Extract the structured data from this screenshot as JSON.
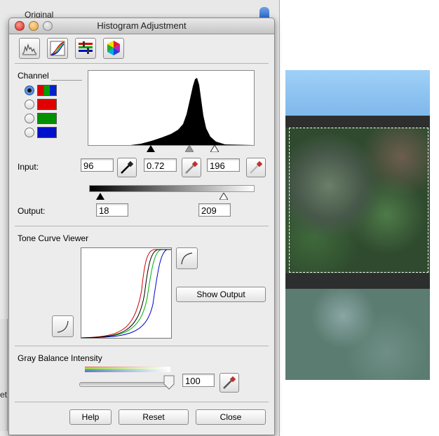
{
  "background_window": {
    "label": "Original",
    "edge_text": "et"
  },
  "dialog": {
    "title": "Histogram Adjustment",
    "toolbar": [
      {
        "icon": "histogram-icon"
      },
      {
        "icon": "tone-curve-icon"
      },
      {
        "icon": "color-balance-icon"
      },
      {
        "icon": "color-wheel-icon"
      }
    ],
    "channel": {
      "label": "Channel",
      "options": [
        {
          "name": "RGB",
          "selected": true,
          "colors": [
            "#e00000",
            "#00a000",
            "#0020d0"
          ]
        },
        {
          "name": "Red",
          "selected": false,
          "colors": [
            "#e00000"
          ]
        },
        {
          "name": "Green",
          "selected": false,
          "colors": [
            "#009000"
          ]
        },
        {
          "name": "Blue",
          "selected": false,
          "colors": [
            "#0010c8"
          ]
        }
      ]
    },
    "input": {
      "label": "Input:",
      "black": "96",
      "gamma": "0.72",
      "white": "196"
    },
    "output": {
      "label": "Output:",
      "black": "18",
      "white": "209"
    },
    "tone_curve": {
      "label": "Tone Curve Viewer",
      "show_output_label": "Show Output"
    },
    "gray_balance": {
      "label": "Gray Balance Intensity",
      "value": "100",
      "slider_level": 1.0
    },
    "buttons": {
      "help": "Help",
      "reset": "Reset",
      "close": "Close"
    }
  },
  "colors": {
    "accent": "#3c78d6",
    "dialog_bg": "#ececec"
  }
}
